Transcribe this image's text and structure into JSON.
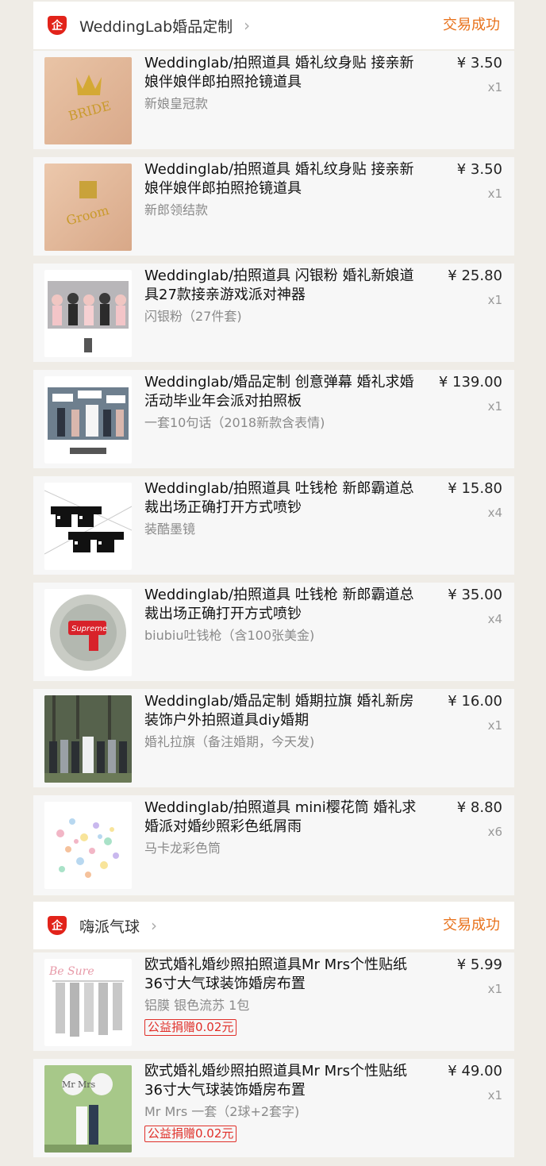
{
  "shops": [
    {
      "logo_text": "企",
      "name": "WeddingLab婚品定制",
      "chevron": "›",
      "status": "交易成功",
      "items": [
        {
          "title": "Weddinglab/拍照道具 婚礼纹身贴 接亲新娘伴娘伴郎拍照抢镜道具",
          "sku": "新娘皇冠款",
          "price": "¥ 3.50",
          "qty": "x1",
          "thumb": "tattoo-crown"
        },
        {
          "title": "Weddinglab/拍照道具 婚礼纹身贴 接亲新娘伴娘伴郎拍照抢镜道具",
          "sku": "新郎领结款",
          "price": "¥ 3.50",
          "qty": "x1",
          "thumb": "tattoo-bowtie"
        },
        {
          "title": "Weddinglab/拍照道具 闪银粉 婚礼新娘道具27款接亲游戏派对神器",
          "sku": "闪银粉（27件套)",
          "price": "¥ 25.80",
          "qty": "x1",
          "thumb": "group-photo"
        },
        {
          "title": "Weddinglab/婚品定制 创意弹幕 婚礼求婚活动毕业年会派对拍照板",
          "sku": "一套10句话（2018新款含表情)",
          "price": "¥ 139.00",
          "qty": "x1",
          "thumb": "photo-boards"
        },
        {
          "title": "Weddinglab/拍照道具 吐钱枪 新郎霸道总裁出场正确打开方式喷钞",
          "sku": "装酷墨镜",
          "price": "¥ 15.80",
          "qty": "x4",
          "thumb": "pixel-sunglasses"
        },
        {
          "title": "Weddinglab/拍照道具 吐钱枪 新郎霸道总裁出场正确打开方式喷钞",
          "sku": "biubiu吐钱枪（含100张美金)",
          "price": "¥ 35.00",
          "qty": "x4",
          "thumb": "money-gun"
        },
        {
          "title": "Weddinglab/婚品定制 婚期拉旗 婚礼新房装饰户外拍照道具diy婚期",
          "sku": "婚礼拉旗（备注婚期，今天发)",
          "price": "¥ 16.00",
          "qty": "x1",
          "thumb": "forest-group"
        },
        {
          "title": "Weddinglab/拍照道具 mini樱花筒 婚礼求婚派对婚纱照彩色纸屑雨",
          "sku": "马卡龙彩色筒",
          "price": "¥ 8.80",
          "qty": "x6",
          "thumb": "confetti"
        }
      ]
    },
    {
      "logo_text": "企",
      "name": "嗨派气球",
      "chevron": "›",
      "status": "交易成功",
      "items": [
        {
          "title": "欧式婚礼婚纱照拍照道具Mr Mrs个性贴纸 36寸大气球装饰婚房布置",
          "sku": "铝膜 银色流苏 1包",
          "price": "¥ 5.99",
          "qty": "x1",
          "charity": "公益捐赠0.02元",
          "thumb": "silver-tassels",
          "thumb_text": "Be Sure"
        },
        {
          "title": "欧式婚礼婚纱照拍照道具Mr Mrs个性贴纸 36寸大气球装饰婚房布置",
          "sku": "Mr Mrs 一套（2球+2套字)",
          "price": "¥ 49.00",
          "qty": "x1",
          "charity": "公益捐赠0.02元",
          "thumb": "couple-balloons",
          "thumb_text": "Mr  Mrs"
        }
      ]
    }
  ],
  "colors": {
    "status": "#e8721c",
    "charity": "#e0302a",
    "logo": "#e2231a"
  }
}
